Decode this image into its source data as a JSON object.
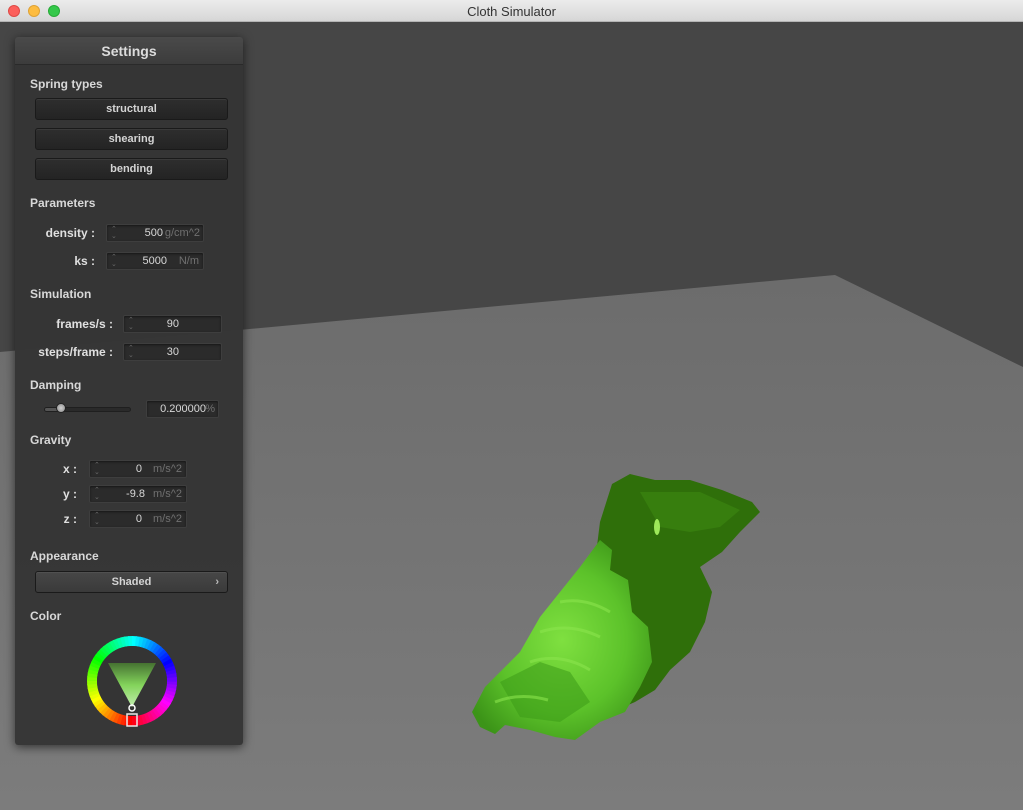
{
  "window": {
    "title": "Cloth Simulator"
  },
  "panel": {
    "title": "Settings",
    "spring_types": {
      "heading": "Spring types",
      "buttons": [
        "structural",
        "shearing",
        "bending"
      ]
    },
    "parameters": {
      "heading": "Parameters",
      "density": {
        "label": "density :",
        "value": "500",
        "unit": "g/cm^2"
      },
      "ks": {
        "label": "ks :",
        "value": "5000",
        "unit": "N/m"
      }
    },
    "simulation": {
      "heading": "Simulation",
      "fps": {
        "label": "frames/s :",
        "value": "90"
      },
      "steps": {
        "label": "steps/frame :",
        "value": "30"
      }
    },
    "damping": {
      "heading": "Damping",
      "value": "0.200000",
      "unit": "%",
      "slider_fraction": 0.2
    },
    "gravity": {
      "heading": "Gravity",
      "x": {
        "label": "x :",
        "value": "0",
        "unit": "m/s^2"
      },
      "y": {
        "label": "y :",
        "value": "-9.8",
        "unit": "m/s^2"
      },
      "z": {
        "label": "z :",
        "value": "0",
        "unit": "m/s^2"
      }
    },
    "appearance": {
      "heading": "Appearance",
      "selected": "Shaded",
      "chevron": "›"
    },
    "color": {
      "heading": "Color",
      "value": "#76d64a"
    }
  },
  "scene": {
    "background_color": "#464646",
    "floor_color": "#7a7a7a",
    "cloth_color_light": "#6fd43a",
    "cloth_color_dark": "#2e6e08"
  }
}
